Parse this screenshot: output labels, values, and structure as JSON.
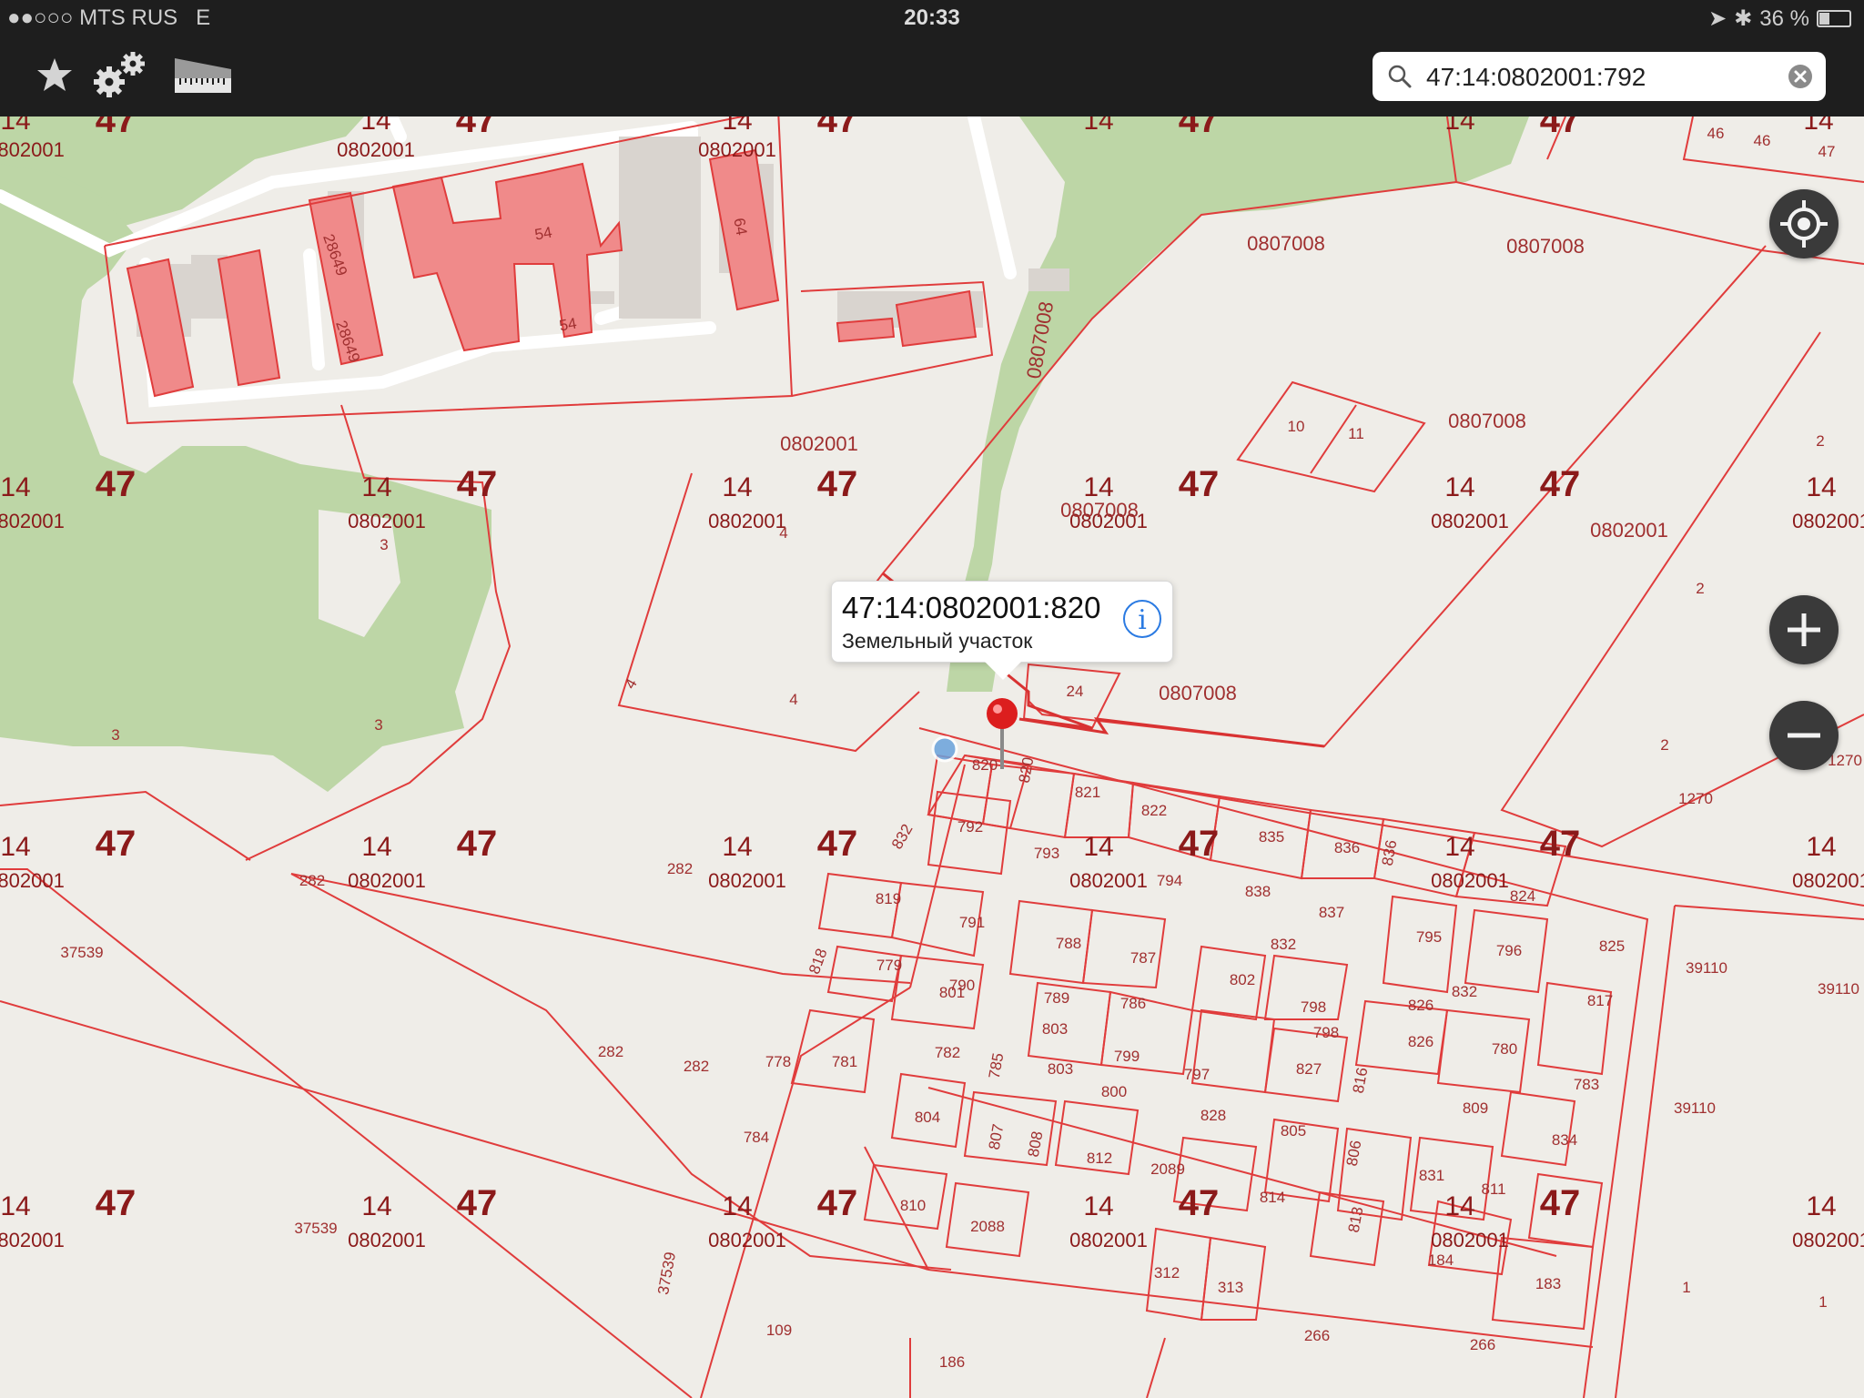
{
  "status_bar": {
    "carrier": "MTS RUS",
    "network": "E",
    "time": "20:33",
    "battery": "36 %",
    "battery_level": 0.36
  },
  "search": {
    "value": "47:14:0802001:792",
    "placeholder": ""
  },
  "callout": {
    "title": "47:14:0802001:820",
    "subtitle": "Земельный участок",
    "info_symbol": "i"
  },
  "map": {
    "grid_region": "47",
    "grid_district": "14",
    "grid_quarter": "0802001",
    "quarter_labels": [
      "0807008",
      "0802001"
    ],
    "parcel_numbers": [
      "820",
      "821",
      "822",
      "835",
      "836",
      "792",
      "793",
      "794",
      "838",
      "837",
      "824",
      "819",
      "791",
      "788",
      "787",
      "832",
      "795",
      "796",
      "825",
      "818",
      "779",
      "790",
      "789",
      "786",
      "802",
      "801",
      "798",
      "826",
      "817",
      "778",
      "781",
      "782",
      "785",
      "803",
      "800",
      "799",
      "797",
      "827",
      "816",
      "780",
      "783",
      "784",
      "804",
      "807",
      "808",
      "812",
      "828",
      "805",
      "806",
      "809",
      "834",
      "2089",
      "814",
      "813",
      "831",
      "811",
      "810",
      "2088",
      "312",
      "313",
      "184",
      "183",
      "109",
      "186",
      "266",
      "282",
      "37539",
      "39110",
      "1270",
      "1",
      "2",
      "3",
      "4",
      "11",
      "10",
      "24",
      "46",
      "47",
      "54",
      "64",
      "28649"
    ]
  },
  "colors": {
    "parcel_border": "#e03c3c",
    "building_fill": "#f08a8a",
    "forest_fill": "#bdd6a6",
    "toolbar_bg": "#1e1e1e",
    "map_bg": "#efede8",
    "label_dark": "#8b1a1a",
    "label_light": "#a03030"
  },
  "icons": {
    "favorites": "star-icon",
    "settings": "gears-icon",
    "measure": "ruler-icon",
    "locate": "crosshair-icon",
    "zoom_in": "plus-icon",
    "zoom_out": "minus-icon",
    "pin": "map-pin-icon",
    "search": "magnifier-icon",
    "clear": "clear-circle-icon",
    "info": "info-icon"
  }
}
